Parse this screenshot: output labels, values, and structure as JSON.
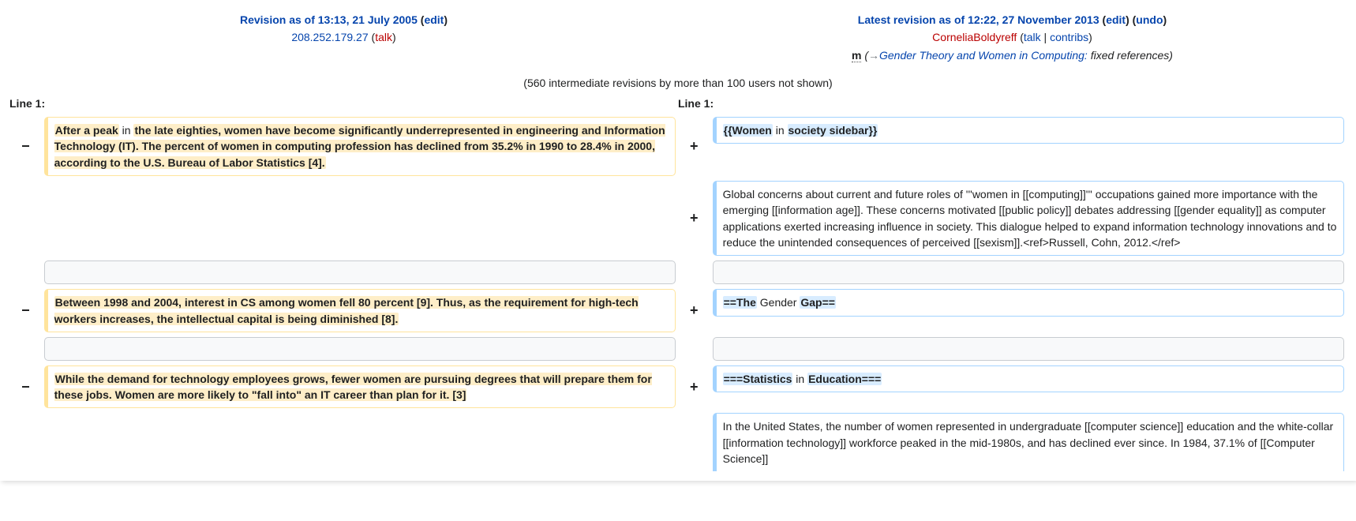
{
  "left": {
    "title_prefix": "Revision as of 13:13, 21 July 2005",
    "edit_label": "edit",
    "user": "208.252.179.27",
    "talk_label": "talk",
    "lineno": "Line 1:"
  },
  "right": {
    "title_prefix": "Latest revision as of 12:22, 27 November 2013",
    "edit_label": "edit",
    "undo_label": "undo",
    "user": "CorneliaBoldyreff",
    "talk_label": "talk",
    "contribs_label": "contribs",
    "minor_flag": "m",
    "arrow": "→",
    "autocomment": "Gender Theory and Women in Computing: ",
    "summary_tail": "fixed references)",
    "lineno": "Line 1:"
  },
  "intermediate": "(560 intermediate revisions by more than 100 users not shown)",
  "rows": {
    "d1_a": "After a peak",
    "d1_b": " in ",
    "d1_c": "the late eighties, women have become significantly underrepresented in engineering and Information Technology (IT). The percent of women in computing profession has declined from 35.2% in 1990 to 28.4% in 2000, according to the U.S. Bureau of Labor Statistics [4].",
    "a1_a": "{{Women",
    "a1_b": " in ",
    "a1_c": "society sidebar}}",
    "a2": "Global concerns about current and future roles of '''women in [[computing]]''' occupations gained more importance with the emerging [[information age]].  These concerns motivated [[public policy]] debates addressing [[gender equality]] as computer applications exerted increasing influence in society. This dialogue helped to expand information technology innovations and to reduce the unintended consequences of perceived [[sexism]].<ref>Russell, Cohn, 2012.</ref>",
    "d2": "Between 1998 and 2004, interest in CS among women fell 80 percent [9]. Thus, as the requirement for high-tech workers increases, the intellectual capital is being diminished [8].",
    "a3_a": "==The",
    "a3_b": " Gender ",
    "a3_c": "Gap==",
    "d3": "While the demand for technology employees grows, fewer women are pursuing degrees that will prepare them for these jobs.  Women are more likely to \"fall into\" an IT career than plan for it. [3]",
    "a4_a": "===Statistics",
    "a4_b": " in ",
    "a4_c": "Education===",
    "a5": "In the United States, the number of women represented in undergraduate [[computer science]] education and the white-collar [[information technology]] workforce peaked in the mid-1980s, and has declined ever since. In 1984, 37.1% of [[Computer Science]]"
  }
}
